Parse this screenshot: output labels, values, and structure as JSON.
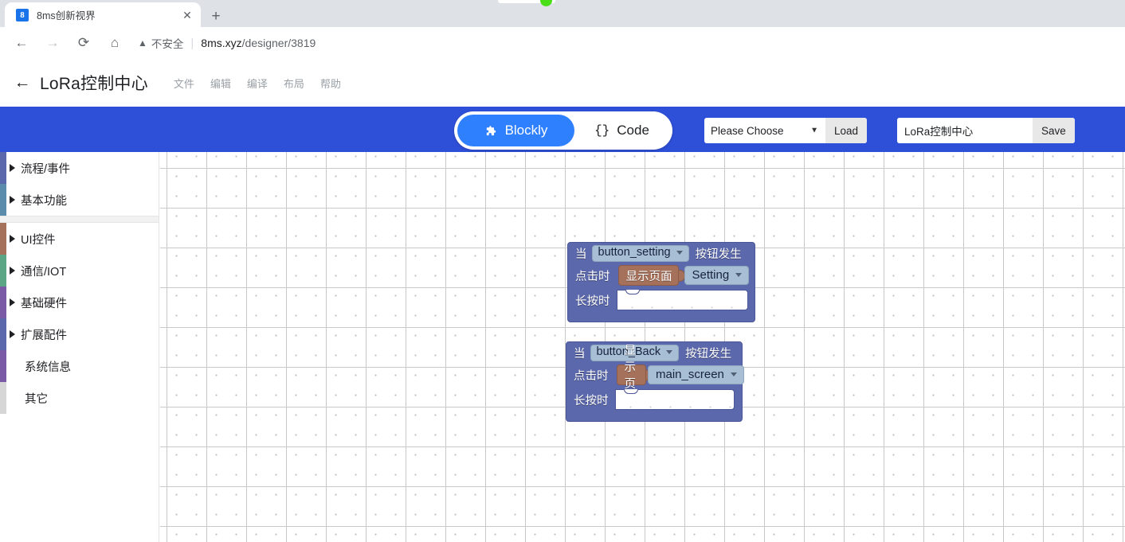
{
  "browser": {
    "tab_title": "8ms创新视界",
    "favicon_text": "8",
    "close_label": "✕",
    "newtab_label": "+",
    "back_label": "←",
    "forward_label": "→",
    "reload_label": "⟳",
    "home_label": "⌂",
    "security_icon": "warning-triangle",
    "security_text": "不安全",
    "url_host": "8ms.xyz",
    "url_path": "/designer/3819"
  },
  "app_header": {
    "back_label": "←",
    "title": "LoRa控制中心",
    "menu": [
      "文件",
      "编辑",
      "编译",
      "布局",
      "帮助"
    ]
  },
  "toolbar": {
    "tabs": [
      {
        "label": "Blockly",
        "icon": "puzzle-piece-icon",
        "active": true
      },
      {
        "label": "Code",
        "icon": "curly-braces-icon",
        "active": false
      }
    ],
    "load_select_value": "Please Choose",
    "load_button": "Load",
    "project_name_value": "LoRa控制中心",
    "save_button": "Save",
    "accent_color": "#2e50d8",
    "active_tab_color": "#2f80ff"
  },
  "sidebar": {
    "groups": [
      {
        "items": [
          {
            "label": "流程/事件",
            "expandable": true,
            "color": "#5b68ab"
          },
          {
            "label": "基本功能",
            "expandable": true,
            "color": "#5b8cab"
          }
        ]
      },
      {
        "items": [
          {
            "label": "UI控件",
            "expandable": true,
            "color": "#a6715a"
          },
          {
            "label": "通信/IOT",
            "expandable": true,
            "color": "#5aa685"
          },
          {
            "label": "基础硬件",
            "expandable": true,
            "color": "#7a5aa6"
          },
          {
            "label": "扩展配件",
            "expandable": true,
            "color": "#5b68ab"
          },
          {
            "label": "系统信息",
            "expandable": false,
            "color": "#7a5aa6"
          },
          {
            "label": "其它",
            "expandable": false,
            "color": "#d6d6d6"
          }
        ]
      }
    ]
  },
  "workspace": {
    "blocks": [
      {
        "when_label": "当",
        "target": "button_setting",
        "event_label": "按钮发生",
        "click_label": "点击时",
        "action_label": "显示页面",
        "action_value": "Setting",
        "longpress_label": "长按时",
        "longpress_value": ""
      },
      {
        "when_label": "当",
        "target": "button_Back",
        "event_label": "按钮发生",
        "click_label": "点击时",
        "action_label": "显示页面",
        "action_value": "main_screen",
        "longpress_label": "长按时",
        "longpress_value": ""
      }
    ],
    "block_colors": {
      "event_block": "#5b68ab",
      "ui_block": "#a6715a",
      "field": "#a7bed4"
    }
  }
}
